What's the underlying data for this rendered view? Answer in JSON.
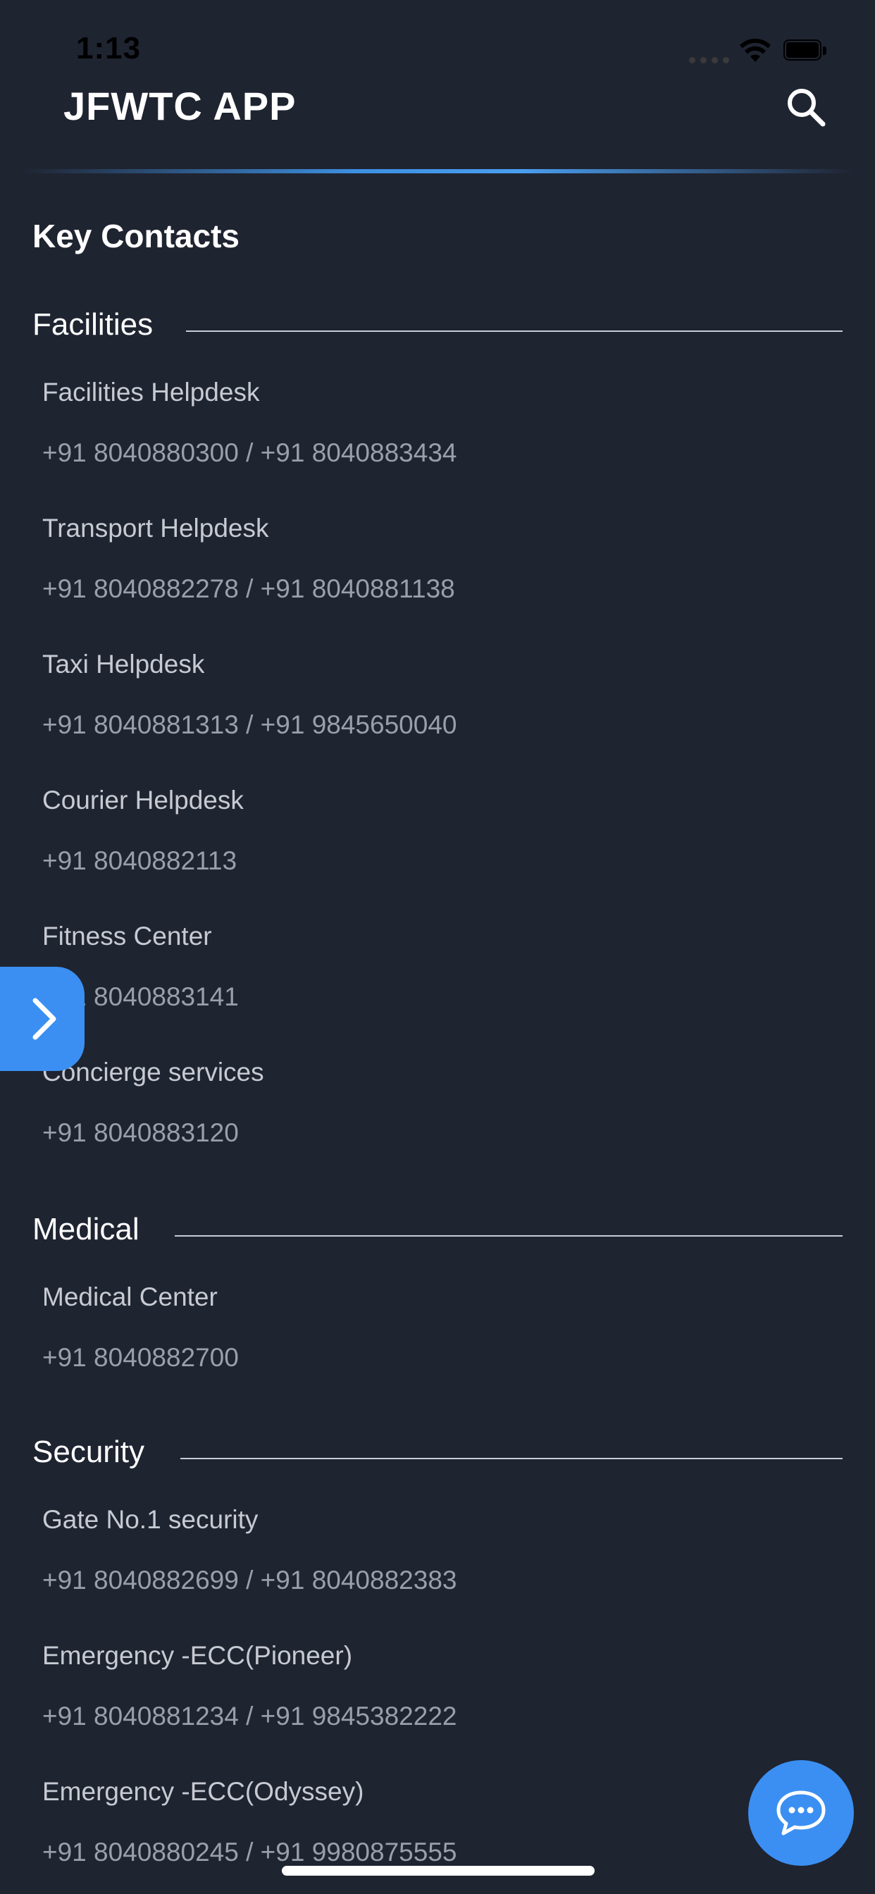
{
  "status_bar": {
    "time": "1:13"
  },
  "header": {
    "title": "JFWTC APP",
    "search_icon": "search-icon"
  },
  "page": {
    "title": "Key Contacts"
  },
  "sections": [
    {
      "title": "Facilities",
      "contacts": [
        {
          "name": "Facilities Helpdesk",
          "phone": "+91 8040880300 / +91 8040883434"
        },
        {
          "name": "Transport Helpdesk",
          "phone": "+91 8040882278 / +91 8040881138"
        },
        {
          "name": "Taxi Helpdesk",
          "phone": "+91 8040881313 / +91 9845650040"
        },
        {
          "name": "Courier Helpdesk",
          "phone": "+91 8040882113"
        },
        {
          "name": "Fitness Center",
          "phone": "+91 8040883141"
        },
        {
          "name": "Concierge services",
          "phone": "+91 8040883120"
        }
      ]
    },
    {
      "title": "Medical",
      "contacts": [
        {
          "name": "Medical Center",
          "phone": "+91 8040882700"
        }
      ]
    },
    {
      "title": "Security",
      "contacts": [
        {
          "name": "Gate No.1 security",
          "phone": "+91 8040882699 / +91 8040882383"
        },
        {
          "name": "Emergency -ECC(Pioneer)",
          "phone": "+91 8040881234 / +91 9845382222"
        },
        {
          "name": "Emergency -ECC(Odyssey)",
          "phone": "+91 8040880245 / +91 9980875555"
        }
      ]
    }
  ],
  "colors": {
    "background": "#1f2431",
    "accent": "#3b8ff2",
    "name_text": "#c7cad1",
    "phone_text": "#9aa0aa"
  },
  "icons": {
    "drawer": "chevron-right-icon",
    "chat": "chat-bubble-icon"
  }
}
